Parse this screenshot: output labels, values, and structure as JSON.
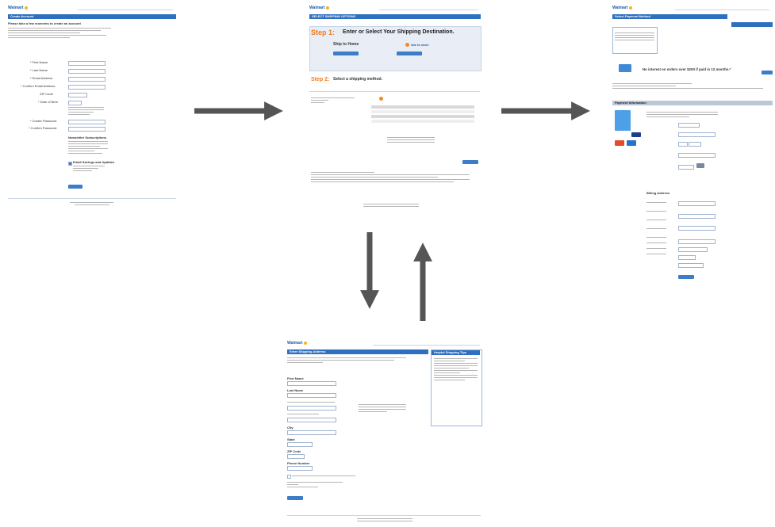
{
  "brand": {
    "name": "Walmart"
  },
  "screens": {
    "create_account": {
      "title": "Create Account",
      "heading": "Please take a few moments to create an account",
      "fields": [
        "* First Name",
        "* Last Name",
        "* Email Address",
        "* Confirm Email Address",
        "ZIP Code",
        "* Date of Birth",
        "* Create Password",
        "* Confirm Password"
      ],
      "newsletter_heading": "Newsletter Subscriptions",
      "newsletter_option": "Email Savings and Updates"
    },
    "shipping_options": {
      "title": "SELECT SHIPPING OPTIONS",
      "step1_number": "Step 1:",
      "step1_text": "Enter or Select Your Shipping Destination.",
      "ship_to_home": "Ship to Home",
      "site_to_store": "site to store",
      "step2_number": "Step 2:",
      "step2_text": "Select a shipping method."
    },
    "payment_method": {
      "title": "Select Payment Method",
      "promo_text": "No interest on orders over $200 if paid in 12 months.*",
      "section_title": "Payment Information",
      "billing_heading": "Billing Address"
    },
    "shipping_address": {
      "title": "Enter Shipping Address",
      "first_name": "First Name",
      "last_name": "Last Name",
      "city": "City",
      "state": "State",
      "zip": "ZIP Code",
      "phone": "Phone Number",
      "sidebar_title": "Helpful Shipping Tips"
    }
  },
  "colors": {
    "bar": "#2f6fbf",
    "accent": "#f07a1c",
    "arrow": "#555555"
  }
}
